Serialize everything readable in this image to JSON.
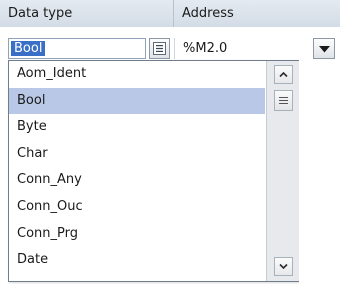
{
  "table": {
    "columns": [
      "Data type",
      "Address"
    ],
    "edit_row": {
      "type_value": "Bool",
      "address_value": "%M2.0"
    }
  },
  "dropdown": {
    "items": [
      "Aom_Ident",
      "Bool",
      "Byte",
      "Char",
      "Conn_Any",
      "Conn_Ouc",
      "Conn_Prg",
      "Date"
    ],
    "selected_item": "Bool"
  },
  "icons": {
    "type_picker": "list-picker-icon",
    "address_dropdown": "caret-down-icon",
    "scroll_up": "chevron-up-icon",
    "scroll_down": "chevron-down-icon",
    "scroll_thumb": "grip-icon"
  },
  "colors": {
    "selection_highlight": "#3a6fc7",
    "list_selected": "#b9c8e6",
    "header_bg": "#dbe2ea"
  }
}
